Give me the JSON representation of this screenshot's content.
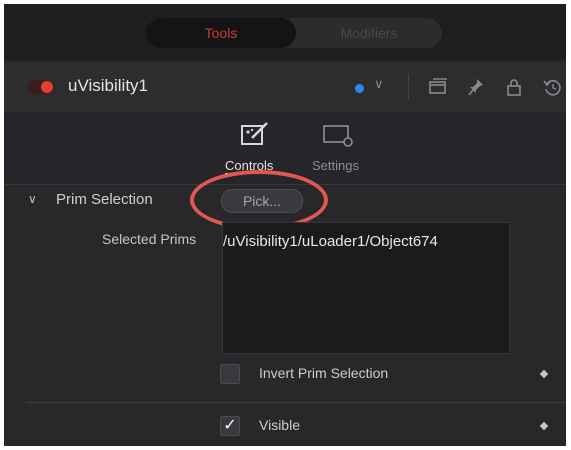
{
  "tabs": [
    {
      "label": "Tools",
      "active": true
    },
    {
      "label": "Modifiers",
      "active": false
    }
  ],
  "tool": {
    "name": "uVisibility1",
    "enabled": true,
    "color_label": "#2a8ae6"
  },
  "header_icons": [
    "window-icon",
    "pin-icon",
    "lock-icon",
    "reset-icon"
  ],
  "subtabs": [
    {
      "label": "Controls",
      "icon": "controls-icon",
      "active": true
    },
    {
      "label": "Settings",
      "icon": "settings-icon",
      "active": false
    }
  ],
  "prim_selection": {
    "section_label": "Prim Selection",
    "pick_label": "Pick...",
    "selected_prims_label": "Selected Prims",
    "selected_prims_value": "/uVisibility1/uLoader1/Object674",
    "invert_label": "Invert Prim Selection",
    "invert_checked": false,
    "visible_label": "Visible",
    "visible_checked": true,
    "checkmark": "✓"
  },
  "colors": {
    "active_tab_text": "#d0382c",
    "power_on": "#e5402f",
    "highlight_ring": "#e2584e"
  }
}
